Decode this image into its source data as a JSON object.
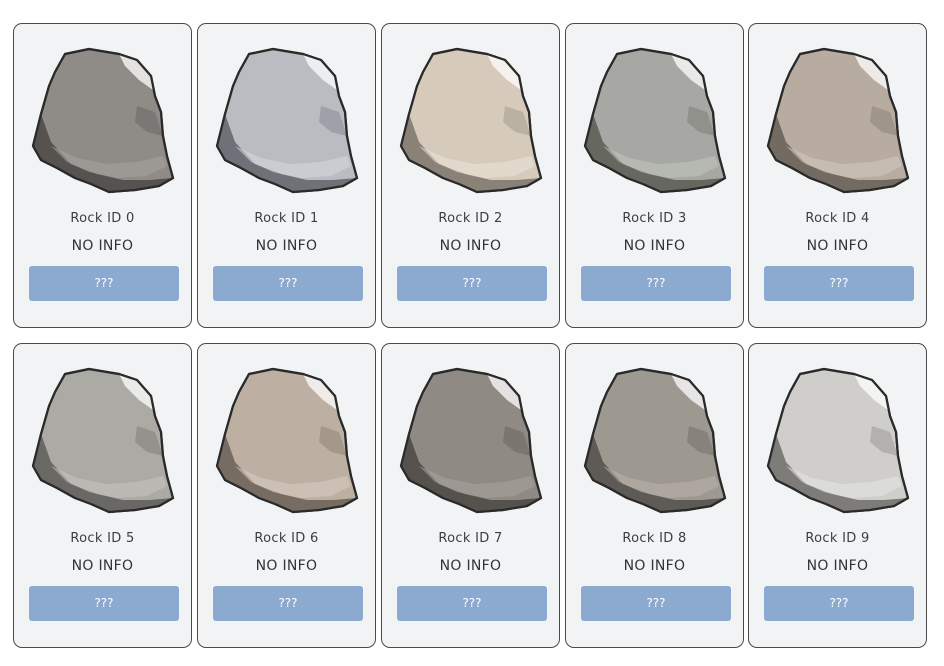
{
  "accent_color": "#8ca9d0",
  "cards": [
    {
      "title": "Rock ID 0",
      "info": "NO INFO",
      "button": "???",
      "fill": "#8f8b87",
      "light": "#a8a49f",
      "dark": "#55524f"
    },
    {
      "title": "Rock ID 1",
      "info": "NO INFO",
      "button": "???",
      "fill": "#b9bcc1",
      "light": "#d7d9dd",
      "dark": "#6e7178"
    },
    {
      "title": "Rock ID 2",
      "info": "NO INFO",
      "button": "???",
      "fill": "#d6cbbb",
      "light": "#ece4d8",
      "dark": "#8a8276"
    },
    {
      "title": "Rock ID 3",
      "info": "NO INFO",
      "button": "???",
      "fill": "#a7a8a3",
      "light": "#c3c4bf",
      "dark": "#66675f"
    },
    {
      "title": "Rock ID 4",
      "info": "NO INFO",
      "button": "???",
      "fill": "#b8aca0",
      "light": "#d4cbc1",
      "dark": "#736a61"
    },
    {
      "title": "Rock ID 5",
      "info": "NO INFO",
      "button": "???",
      "fill": "#acaaa5",
      "light": "#c7c5c0",
      "dark": "#6a6864"
    },
    {
      "title": "Rock ID 6",
      "info": "NO INFO",
      "button": "???",
      "fill": "#bdb0a2",
      "light": "#d8cec3",
      "dark": "#766c62"
    },
    {
      "title": "Rock ID 7",
      "info": "NO INFO",
      "button": "???",
      "fill": "#8f8a83",
      "light": "#a9a49d",
      "dark": "#55514c"
    },
    {
      "title": "Rock ID 8",
      "info": "NO INFO",
      "button": "???",
      "fill": "#9d9890",
      "light": "#b9b4ad",
      "dark": "#5e5a55"
    },
    {
      "title": "Rock ID 9",
      "info": "NO INFO",
      "button": "???",
      "fill": "#cfcecb",
      "light": "#e6e5e3",
      "dark": "#7d7c78"
    }
  ]
}
